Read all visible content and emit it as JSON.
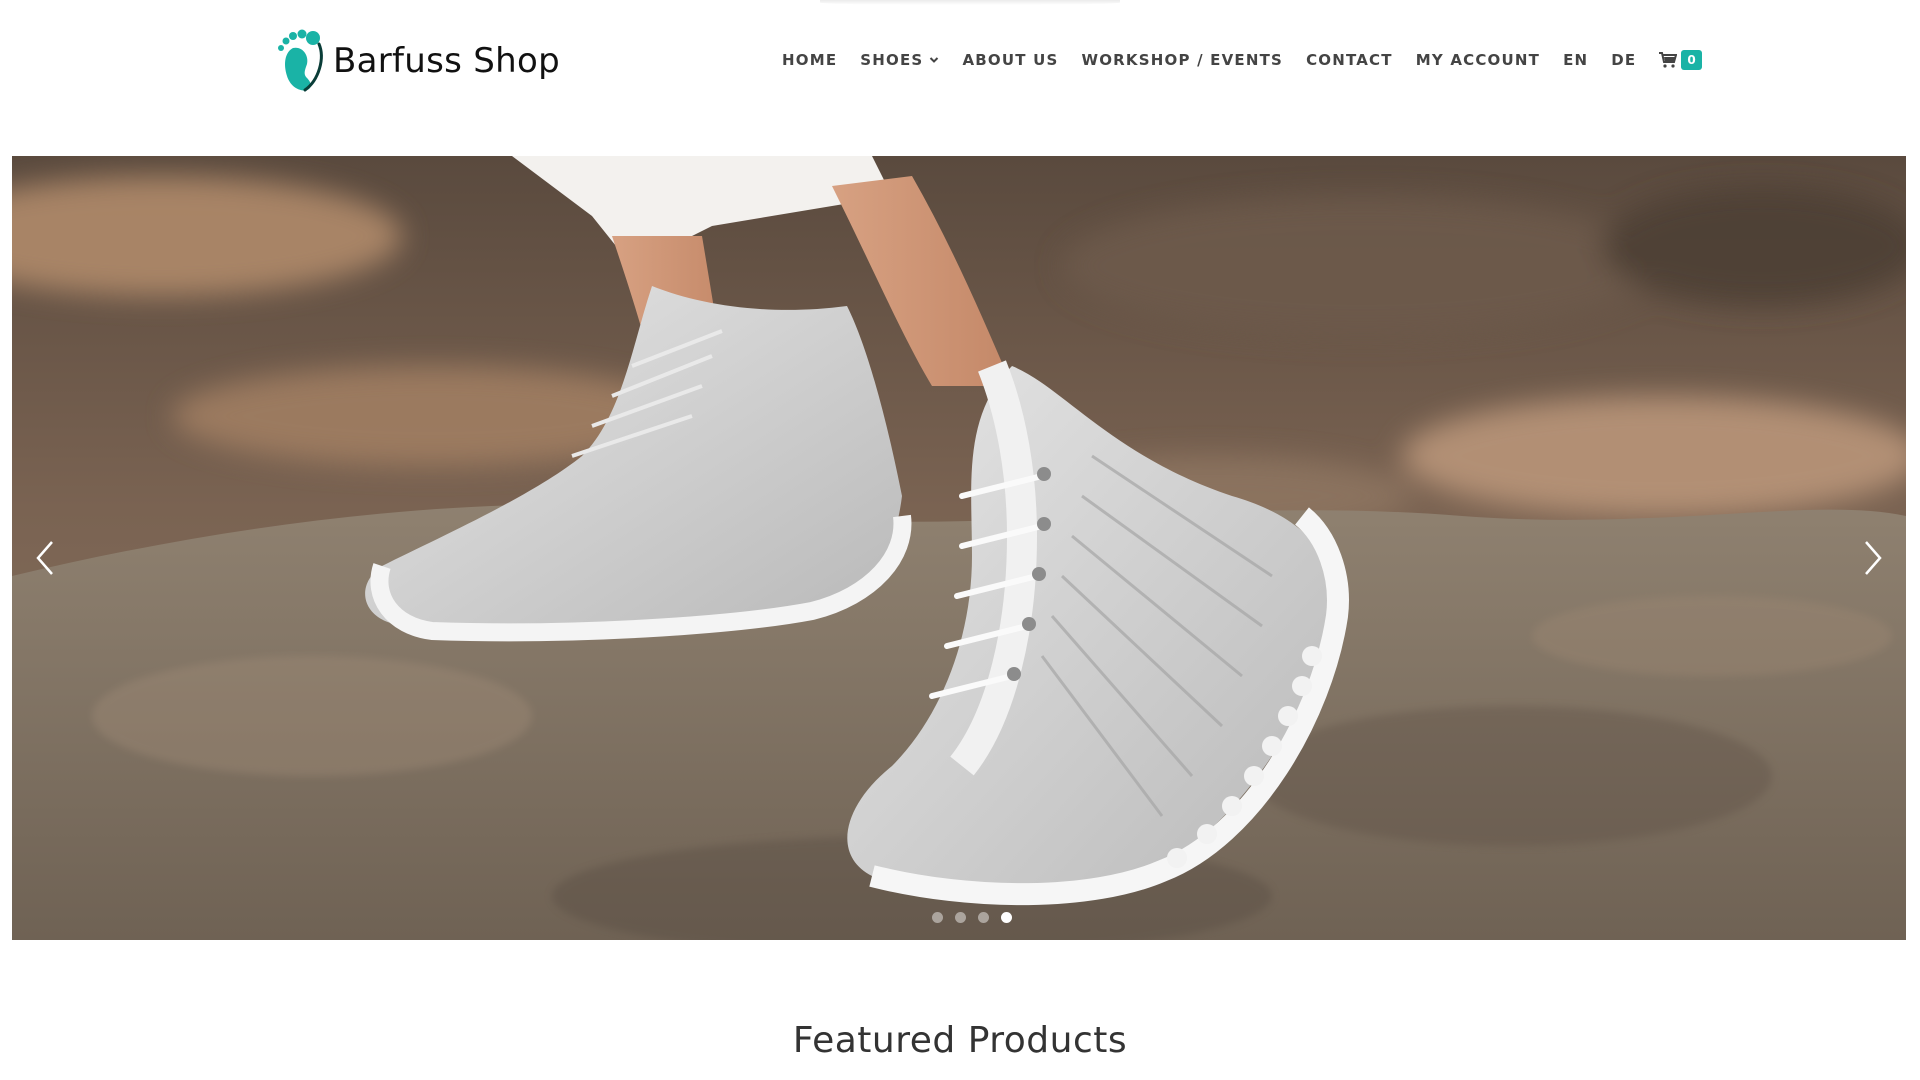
{
  "brand": {
    "name": "Barfuss Shop",
    "accent_color": "#1ab3a6",
    "logo_icon": "footprint-icon"
  },
  "nav": {
    "items": [
      {
        "label": "HOME"
      },
      {
        "label": "SHOES",
        "has_dropdown": true
      },
      {
        "label": "ABOUT US"
      },
      {
        "label": "WORKSHOP / EVENTS"
      },
      {
        "label": "CONTACT"
      },
      {
        "label": "MY ACCOUNT"
      },
      {
        "label": "EN"
      },
      {
        "label": "DE"
      }
    ],
    "cart": {
      "icon": "cart-icon",
      "count": "0"
    }
  },
  "hero": {
    "slide_count": 4,
    "active_slide": 4,
    "prev_icon": "chevron-left-icon",
    "next_icon": "chevron-right-icon"
  },
  "featured": {
    "title": "Featured Products"
  }
}
